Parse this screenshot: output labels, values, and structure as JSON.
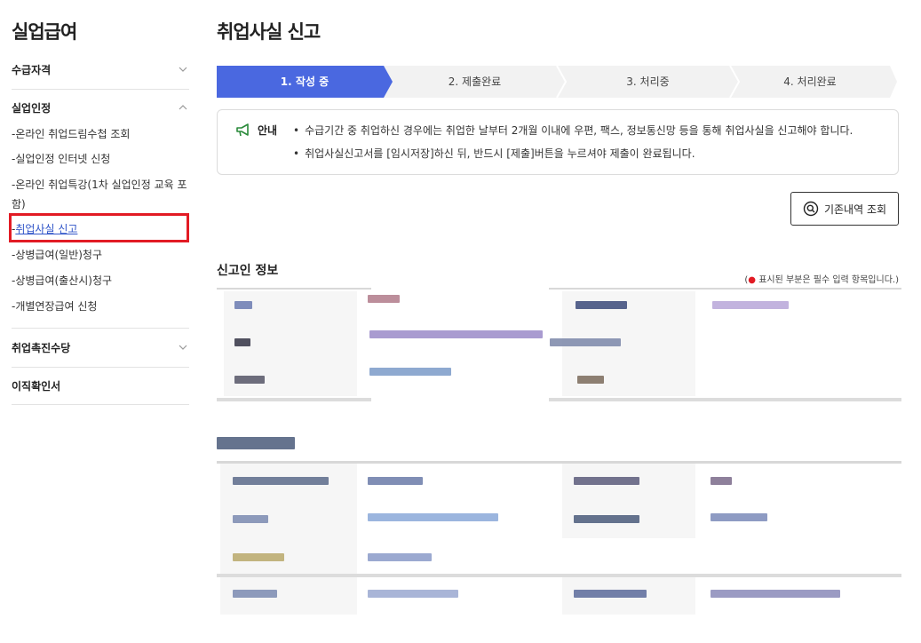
{
  "sidebar": {
    "title": "실업급여",
    "sections": [
      {
        "label": "수급자격",
        "expanded": false
      },
      {
        "label": "실업인정",
        "expanded": true
      },
      {
        "label": "취업촉진수당",
        "expanded": false
      },
      {
        "label": "이직확인서",
        "expanded": false
      }
    ],
    "sub_items": [
      "-온라인 취업드림수첩 조회",
      "-실업인정 인터넷 신청",
      "-온라인 취업특강(1차 실업인정 교육 포함)",
      "취업사실 신고",
      "-상병급여(일반)청구",
      "-상병급여(출산시)청구",
      "-개별연장급여 신청"
    ],
    "active_prefix": "-"
  },
  "page": {
    "title": "취업사실 신고"
  },
  "steps": [
    {
      "label": "1. 작성 중",
      "active": true
    },
    {
      "label": "2. 제출완료",
      "active": false
    },
    {
      "label": "3. 처리중",
      "active": false
    },
    {
      "label": "4. 처리완료",
      "active": false
    }
  ],
  "colors": {
    "accent": "#4a68e0",
    "highlight": "#e21b24",
    "active_link": "#2f54c8"
  },
  "notice": {
    "label": "안내",
    "icon": "megaphone-icon",
    "lines": [
      "수급기간 중 취업하신 경우에는 취업한 날부터 2개월 이내에 우편, 팩스, 정보통신망 등을 통해 취업사실을 신고해야 합니다.",
      "취업사실신고서를 [임시저장]하신 뒤, 반드시 [제출]버튼을 누르셔야 제출이 완료됩니다."
    ]
  },
  "history_button": {
    "label": "기존내역 조회",
    "icon": "search-icon"
  },
  "reporter_section": {
    "title": "신고인 정보",
    "required_note_prefix": "(",
    "required_note_text": " 표시된 부분은 필수 입력 항목입니다.)"
  }
}
